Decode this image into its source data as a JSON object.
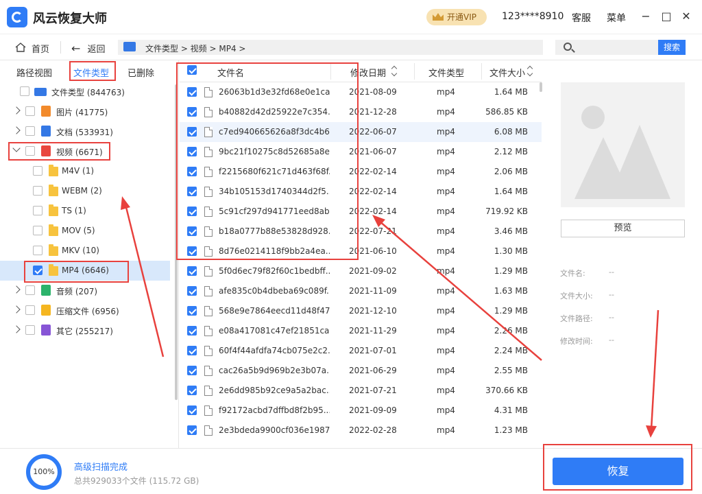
{
  "app": {
    "title": "风云恢复大师"
  },
  "titlebar": {
    "vip_label": "开通VIP",
    "phone": "123****8910",
    "service_label": "客服",
    "menu_label": "菜单",
    "minimize": "−",
    "maximize": "□",
    "close": "✕"
  },
  "nav": {
    "home_label": "首页",
    "back_label": "返回",
    "path": "文件类型 > 视频 > MP4 >",
    "search_placeholder": "",
    "search_button": "搜索"
  },
  "left_tabs": [
    "路径视图",
    "文件类型",
    "已删除"
  ],
  "tree": [
    {
      "label": "文件类型 (844763)",
      "checked": false,
      "icon": "drive-icon",
      "color": "#3478e5"
    },
    {
      "label": "图片 (41775)",
      "checked": false,
      "icon": "image-file-icon",
      "color": "#f28a2b"
    },
    {
      "label": "文档 (533931)",
      "checked": false,
      "icon": "document-file-icon",
      "color": "#3478e5"
    },
    {
      "label": "视频 (6671)",
      "checked": false,
      "icon": "video-file-icon",
      "color": "#e9473f"
    },
    {
      "label": "M4V (1)",
      "checked": false,
      "icon": "folder-icon"
    },
    {
      "label": "WEBM (2)",
      "checked": false,
      "icon": "folder-icon"
    },
    {
      "label": "TS (1)",
      "checked": false,
      "icon": "folder-icon"
    },
    {
      "label": "MOV (5)",
      "checked": false,
      "icon": "folder-icon"
    },
    {
      "label": "MKV (10)",
      "checked": false,
      "icon": "folder-icon"
    },
    {
      "label": "MP4 (6646)",
      "checked": true,
      "icon": "folder-icon"
    },
    {
      "label": "音频 (207)",
      "checked": false,
      "icon": "audio-file-icon",
      "color": "#2cb36b"
    },
    {
      "label": "压缩文件 (6956)",
      "checked": false,
      "icon": "archive-file-icon",
      "color": "#f5b620"
    },
    {
      "label": "其它 (255217)",
      "checked": false,
      "icon": "other-file-icon",
      "color": "#8755d6"
    }
  ],
  "table": {
    "headers": {
      "name": "文件名",
      "date": "修改日期",
      "type": "文件类型",
      "size": "文件大小"
    },
    "rows": [
      {
        "name": "26063b1d3e32fd68e0e1ca...",
        "date": "2021-08-09",
        "type": "mp4",
        "size": "1.64 MB"
      },
      {
        "name": "b40882d42d25922e7c354...",
        "date": "2021-12-28",
        "type": "mp4",
        "size": "586.85  KB"
      },
      {
        "name": "c7ed940665626a8f3dc4b6...",
        "date": "2022-06-07",
        "type": "mp4",
        "size": "6.08 MB"
      },
      {
        "name": "9bc21f10275c8d52685a8e...",
        "date": "2021-06-07",
        "type": "mp4",
        "size": "2.12 MB"
      },
      {
        "name": "f2215680f621c71d463f68f...",
        "date": "2022-02-14",
        "type": "mp4",
        "size": "2.06 MB"
      },
      {
        "name": "34b105153d1740344d2f5...",
        "date": "2022-02-14",
        "type": "mp4",
        "size": "1.64 MB"
      },
      {
        "name": "5c91cf297d941771eed8ab...",
        "date": "2022-02-14",
        "type": "mp4",
        "size": "719.92  KB"
      },
      {
        "name": "b18a0777b88e53828d928...",
        "date": "2022-07-21",
        "type": "mp4",
        "size": "3.46 MB"
      },
      {
        "name": "8d76e0214118f9bb2a4ea...",
        "date": "2021-06-10",
        "type": "mp4",
        "size": "1.30 MB"
      },
      {
        "name": "5f0d6ec79f82f60c1bedbff...",
        "date": "2021-09-02",
        "type": "mp4",
        "size": "1.29 MB"
      },
      {
        "name": "afe835c0b4dbeba69c089f...",
        "date": "2021-11-09",
        "type": "mp4",
        "size": "1.63 MB"
      },
      {
        "name": "568e9e7864eecd11d48f47...",
        "date": "2021-12-10",
        "type": "mp4",
        "size": "1.29 MB"
      },
      {
        "name": "e08a417081c47ef21851ca...",
        "date": "2021-11-29",
        "type": "mp4",
        "size": "2.26 MB"
      },
      {
        "name": "60f4f44afdfa74cb075e2c2...",
        "date": "2021-07-01",
        "type": "mp4",
        "size": "2.24 MB"
      },
      {
        "name": "cac26a5b9d969b2e3b07a...",
        "date": "2021-06-29",
        "type": "mp4",
        "size": "2.55 MB"
      },
      {
        "name": "2e6dd985b92ce9a5a2bac...",
        "date": "2021-07-21",
        "type": "mp4",
        "size": "370.66  KB"
      },
      {
        "name": "f92172acbd7dffbd8f2b95...",
        "date": "2021-09-09",
        "type": "mp4",
        "size": "4.31 MB"
      },
      {
        "name": "2e3bdeda9900cf036e1987...",
        "date": "2022-02-28",
        "type": "mp4",
        "size": "1.23 MB"
      }
    ]
  },
  "preview": {
    "button": "预览",
    "info": [
      {
        "label": "文件名:",
        "value": "--"
      },
      {
        "label": "文件大小:",
        "value": "--"
      },
      {
        "label": "文件路径:",
        "value": "--"
      },
      {
        "label": "修改时间:",
        "value": "--"
      }
    ]
  },
  "footer": {
    "progress_percent": 100,
    "progress_label": "100%",
    "scan_title": "高级扫描完成",
    "scan_summary": "总共929033个文件 (115.72 GB)",
    "recover_button": "恢复"
  },
  "colors": {
    "accent": "#2f7cf6",
    "annotation": "#e8413d",
    "selected_row": "#d8e8fb"
  }
}
